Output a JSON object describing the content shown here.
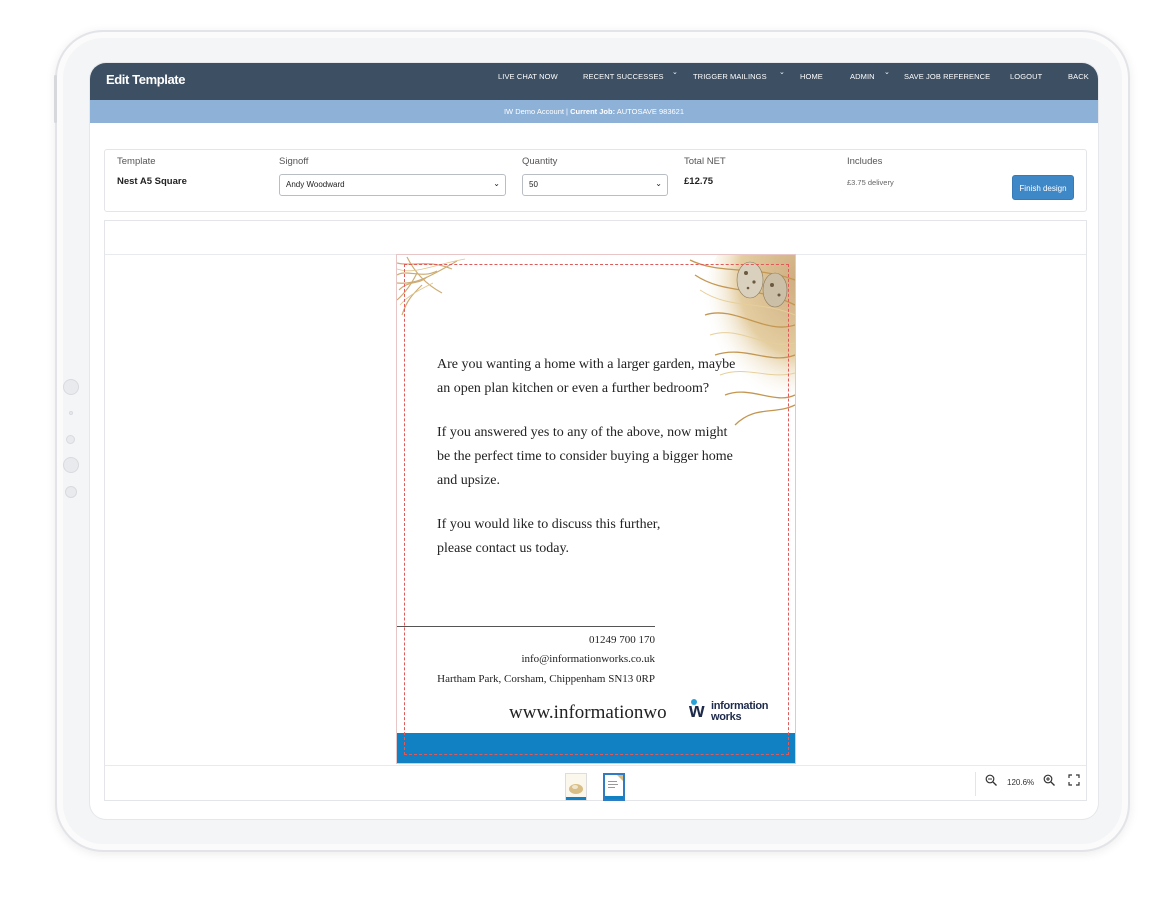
{
  "header": {
    "title": "Edit Template",
    "nav": [
      {
        "label": "LIVE CHAT NOW",
        "caret": false
      },
      {
        "label": "RECENT SUCCESSES",
        "caret": true
      },
      {
        "label": "TRIGGER MAILINGS",
        "caret": true
      },
      {
        "label": "HOME",
        "caret": false
      },
      {
        "label": "ADMIN",
        "caret": true
      },
      {
        "label": "SAVE JOB REFERENCE",
        "caret": false
      },
      {
        "label": "LOGOUT",
        "caret": false
      },
      {
        "label": "BACK",
        "caret": false
      }
    ]
  },
  "subbar": {
    "account": "IW Demo Account | ",
    "job_label": "Current Job:",
    "job_value": " AUTOSAVE 983621"
  },
  "info": {
    "template_label": "Template",
    "template_value": "Nest A5 Square",
    "signoff_label": "Signoff",
    "signoff_value": "Andy Woodward",
    "quantity_label": "Quantity",
    "quantity_value": "50",
    "total_label": "Total NET",
    "total_value": "£12.75",
    "includes_label": "Includes",
    "includes_value": "£3.75 delivery",
    "finish_button": "Finish design"
  },
  "document": {
    "paragraph1_line1": "Are you wanting a home with a larger garden, maybe",
    "paragraph1_line2": "an open plan kitchen or even a further bedroom?",
    "paragraph2_line1": "If you answered yes to any of the above, now might",
    "paragraph2_line2": "be the perfect time to consider buying a bigger home",
    "paragraph2_line3": "and upsize.",
    "paragraph3_line1": "If you would like to discuss this further,",
    "paragraph3_line2": "please contact us today.",
    "phone": "01249 700 170",
    "email": "info@informationworks.co.uk",
    "address": "Hartham Park, Corsham, Chippenham SN13 0RP",
    "website": "www.informationwo",
    "logo_line1": "information",
    "logo_line2": "works",
    "band_color": "#1181c3"
  },
  "footer": {
    "zoom_level": "120.6%"
  },
  "colors": {
    "nav_bg": "#3d4f63",
    "subbar_bg": "#8eb1d8",
    "accent": "#3f88c8",
    "trim_line": "#e05a5a"
  }
}
